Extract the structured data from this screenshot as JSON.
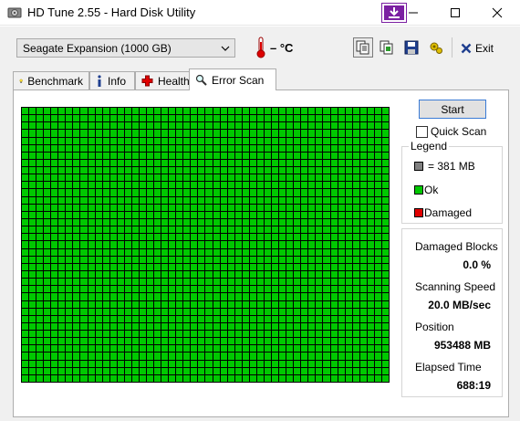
{
  "window": {
    "title": "HD Tune 2.55 - Hard Disk Utility",
    "icon": "hdtune-app-icon",
    "extension_icon": "arrow-down-icon",
    "controls": [
      "minimize-icon",
      "maximize-icon",
      "close-icon"
    ]
  },
  "toolbar": {
    "drive": "Seagate Expansion (1000 GB)",
    "temperature": "– °C",
    "buttons": [
      "copy-icon",
      "copy-info-icon",
      "save-icon",
      "options-icon"
    ],
    "exit_label": "Exit"
  },
  "tabs": [
    {
      "label": "Benchmark",
      "icon": "lightbulb-icon"
    },
    {
      "label": "Info",
      "icon": "info-icon"
    },
    {
      "label": "Health",
      "icon": "health-cross-icon"
    },
    {
      "label": "Error Scan",
      "icon": "magnifier-icon",
      "active": true
    }
  ],
  "scan": {
    "start_label": "Start",
    "quick_scan_label": "Quick Scan",
    "quick_scan_checked": false,
    "block_color": "#00c800"
  },
  "legend": {
    "title": "Legend",
    "items": [
      {
        "label": "= 381 MB",
        "color": "#808080"
      },
      {
        "label": "Ok",
        "color": "#00c800"
      },
      {
        "label": "Damaged",
        "color": "#e00000"
      }
    ]
  },
  "stats": {
    "damaged_blocks_label": "Damaged Blocks",
    "damaged_blocks_value": "0.0 %",
    "scanning_speed_label": "Scanning Speed",
    "scanning_speed_value": "20.0 MB/sec",
    "position_label": "Position",
    "position_value": "953488 MB",
    "elapsed_label": "Elapsed Time",
    "elapsed_value": "688:19"
  }
}
